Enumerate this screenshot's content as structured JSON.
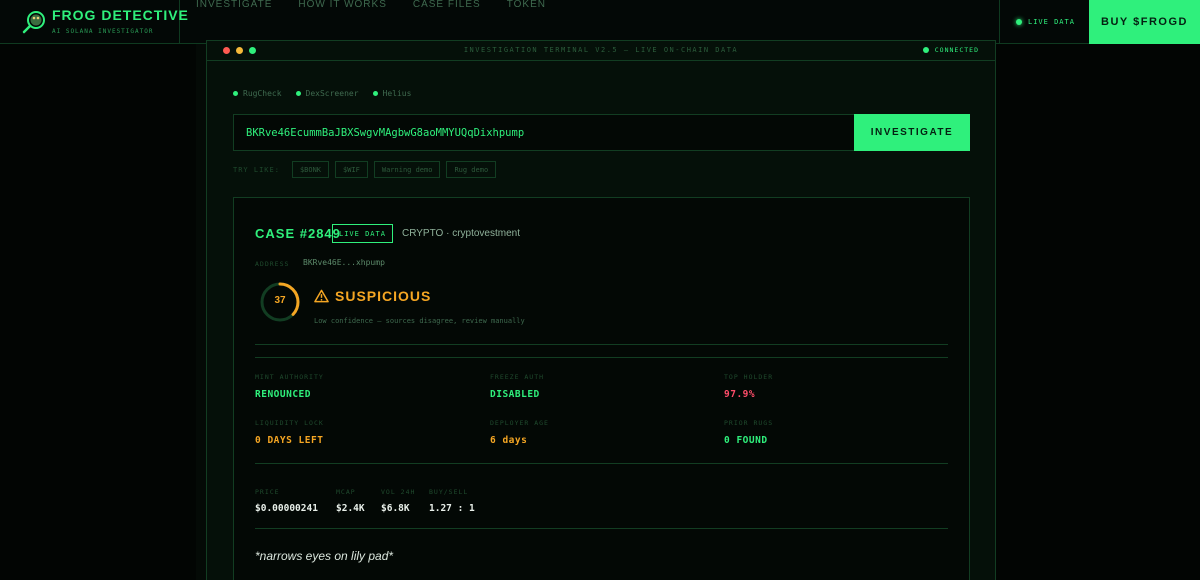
{
  "brand": {
    "title": "FROG DETECTIVE",
    "subtitle": "AI SOLANA INVESTIGATOR",
    "logo_icon": "frog-magnifier-icon"
  },
  "nav": {
    "links": [
      "INVESTIGATE",
      "HOW IT WORKS",
      "CASE FILES",
      "TOKEN"
    ],
    "live_label": "LIVE DATA",
    "buy_label": "BUY $FROGD"
  },
  "terminal": {
    "title": "INVESTIGATION TERMINAL V2.5 — LIVE ON-CHAIN DATA",
    "status": "CONNECTED",
    "sources": [
      "RugCheck",
      "DexScreener",
      "Helius"
    ],
    "input_value": "BKRve46EcummBaJBXSwgvMAgbwG8aoMMYUQqDixhpump",
    "input_placeholder": "",
    "investigate_label": "INVESTIGATE",
    "try_label": "TRY LIKE:",
    "chips": [
      "$BONK",
      "$WIF",
      "Warning demo",
      "Rug demo"
    ]
  },
  "case": {
    "title": "CASE #2849",
    "badge": "LIVE DATA",
    "meta": "CRYPTO · cryptovestment",
    "address_label": "ADDRESS",
    "address_short": "BKRve46E...xhpump",
    "score": "37",
    "score_fraction": 0.37,
    "verdict": "SUSPICIOUS",
    "verdict_note": "Low confidence — sources disagree, review manually",
    "metrics": [
      {
        "label": "MINT AUTHORITY",
        "value": "RENOUNCED",
        "status": "good"
      },
      {
        "label": "FREEZE AUTH",
        "value": "DISABLED",
        "status": "good"
      },
      {
        "label": "TOP HOLDER",
        "value": "97.9%",
        "status": "bad"
      },
      {
        "label": "LIQUIDITY LOCK",
        "value": "0 DAYS LEFT",
        "status": "warn"
      },
      {
        "label": "DEPLOYER AGE",
        "value": "6 days",
        "status": "warn"
      },
      {
        "label": "PRIOR RUGS",
        "value": "0 FOUND",
        "status": "good"
      }
    ],
    "market": [
      {
        "label": "PRICE",
        "value": "$0.00000241"
      },
      {
        "label": "MCAP",
        "value": "$2.4K"
      },
      {
        "label": "VOL 24H",
        "value": "$6.8K"
      },
      {
        "label": "BUY/SELL",
        "value": "1.27 : 1"
      }
    ],
    "quote": "*narrows eyes on lily pad*"
  },
  "colors": {
    "accent": "#2ff07c",
    "warn": "#f5a623",
    "bad": "#ff4d6a",
    "background": "#020503"
  }
}
